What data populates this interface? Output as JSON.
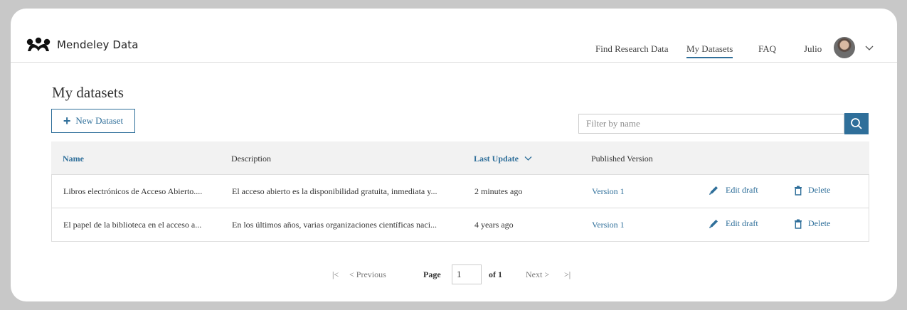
{
  "app": {
    "logo_text": "Mendeley Data",
    "brand_color": "#2f6f9a"
  },
  "nav": {
    "find_research_data": "Find Research Data",
    "my_datasets": "My Datasets",
    "faq": "FAQ",
    "user_name": "Julio"
  },
  "page": {
    "title": "My datasets",
    "new_dataset_label": "New Dataset",
    "filter_placeholder": "Filter by name"
  },
  "table": {
    "columns": {
      "name": "Name",
      "description": "Description",
      "last_update": "Last Update",
      "published_version": "Published Version"
    },
    "rows": [
      {
        "name": "Libros electrónicos de Acceso Abierto....",
        "description": "El acceso abierto es la disponibilidad gratuita, inmediata y...",
        "last_update": "2 minutes ago",
        "version": "Version 1",
        "edit_label": "Edit draft",
        "delete_label": "Delete"
      },
      {
        "name": "El papel de la biblioteca en el acceso a...",
        "description": "En los últimos años, varias organizaciones científicas naci...",
        "last_update": "4 years ago",
        "version": "Version 1",
        "edit_label": "Edit draft",
        "delete_label": "Delete"
      }
    ]
  },
  "pager": {
    "first": "|<",
    "previous": "< Previous",
    "page_label": "Page",
    "page_value": "1",
    "of_label": "of 1",
    "next": "Next >",
    "last": ">|"
  }
}
